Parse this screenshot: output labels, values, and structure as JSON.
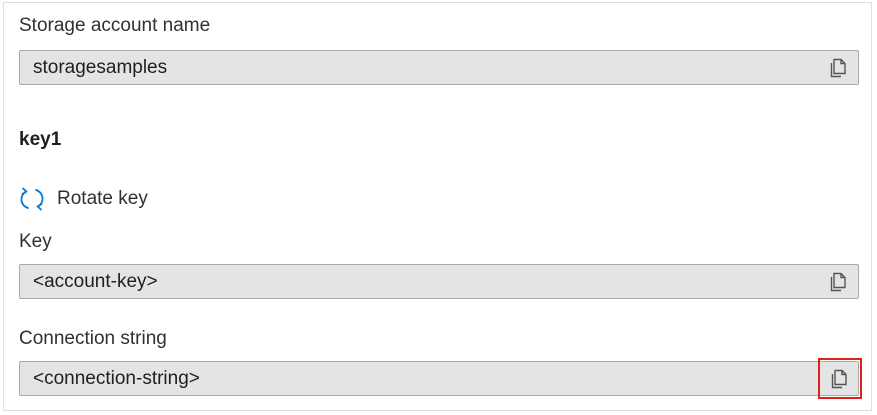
{
  "account": {
    "label": "Storage account name",
    "value": "storagesamples"
  },
  "key_section": {
    "heading": "key1",
    "rotate_label": "Rotate key",
    "key_label": "Key",
    "key_value": "<account-key>",
    "connection_label": "Connection string",
    "connection_value": "<connection-string>"
  },
  "icons": {
    "copy": "copy-icon",
    "rotate": "rotate-icon"
  },
  "colors": {
    "field_bg": "#e4e4e4",
    "field_border": "#a9a9a9",
    "highlight": "#e0201b",
    "rotate_icon": "#0078d4"
  }
}
